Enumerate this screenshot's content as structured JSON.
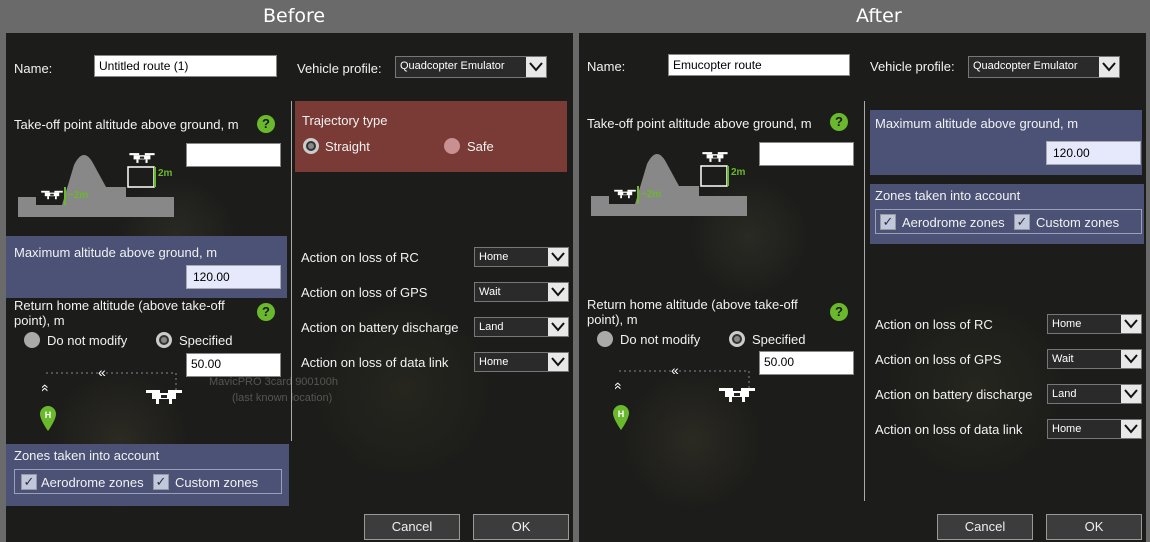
{
  "before": {
    "heading": "Before",
    "name_label": "Name:",
    "name_value": "Untitled route (1)",
    "vehicle_label": "Vehicle profile:",
    "vehicle_value": "Quadcopter Emulator",
    "takeoff_label": "Take-off point altitude above ground, m",
    "diagram_2m": "2m",
    "diagram_neg2m": "−2m",
    "max_alt_label": "Maximum altitude above ground, m",
    "max_alt_value": "120.00",
    "return_label_1": "Return home altitude (above take-off",
    "return_label_2": "point), m",
    "opt_not_modify": "Do not modify",
    "opt_specified": "Specified",
    "return_value": "50.00",
    "zones_label": "Zones taken into account",
    "aerodrome": "Aerodrome zones",
    "custom": "Custom zones",
    "trajectory_label": "Trajectory type",
    "traj_straight": "Straight",
    "traj_safe": "Safe",
    "rc_label": "Action on loss of RC",
    "rc_value": "Home",
    "gps_label": "Action on loss of GPS",
    "gps_value": "Wait",
    "battery_label": "Action on battery discharge",
    "battery_value": "Land",
    "datalink_label": "Action on loss of data link",
    "datalink_value": "Home",
    "map_text_1": "MavicPRO 3card 900100h",
    "map_text_2": "(last known location)",
    "cancel": "Cancel",
    "ok": "OK"
  },
  "after": {
    "heading": "After",
    "name_label": "Name:",
    "name_value": "Emucopter route",
    "vehicle_label": "Vehicle profile:",
    "vehicle_value": "Quadcopter Emulator",
    "takeoff_label": "Take-off point altitude above ground, m",
    "diagram_2m": "2m",
    "diagram_neg2m": "−2m",
    "max_alt_label": "Maximum altitude above ground, m",
    "max_alt_value": "120.00",
    "zones_label": "Zones taken into account",
    "aerodrome": "Aerodrome zones",
    "custom": "Custom zones",
    "return_label_1": "Return home altitude (above take-off",
    "return_label_2": "point), m",
    "opt_not_modify": "Do not modify",
    "opt_specified": "Specified",
    "return_value": "50.00",
    "rc_label": "Action on loss of RC",
    "rc_value": "Home",
    "gps_label": "Action on loss of GPS",
    "gps_value": "Wait",
    "battery_label": "Action on battery discharge",
    "battery_value": "Land",
    "datalink_label": "Action on loss of data link",
    "datalink_value": "Home",
    "cancel": "Cancel",
    "ok": "OK"
  },
  "colors": {
    "help_green": "#6ab82c",
    "zone_blue": "#4b5275",
    "trajectory_red": "#7a3a35"
  }
}
